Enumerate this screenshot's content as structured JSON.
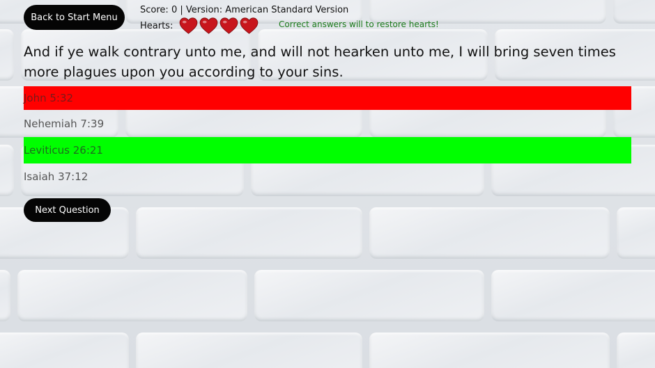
{
  "header": {
    "back_button_label": "Back to Start Menu",
    "score_label": "Score:",
    "score_value": "0",
    "separator": "|",
    "version_label": "Version:",
    "version_value": "American Standard Version",
    "hearts_label": "Hearts:",
    "hearts_count": 4,
    "heart_color": "#c8161d",
    "restore_message": "Correct answers will to restore hearts!"
  },
  "question": {
    "text": "And if ye walk contrary unto me, and will not hearken unto me, I will bring seven times more plagues upon you according to your sins."
  },
  "answers": [
    {
      "label": "John 5:32",
      "state": "wrong"
    },
    {
      "label": "Nehemiah 7:39",
      "state": "neutral"
    },
    {
      "label": "Leviticus 26:21",
      "state": "correct"
    },
    {
      "label": "Isaiah 37:12",
      "state": "neutral"
    }
  ],
  "footer": {
    "next_button_label": "Next Question"
  },
  "colors": {
    "wrong_answer_bg": "#ff0000",
    "correct_answer_bg": "#00ff00",
    "button_bg": "#050505",
    "restore_message": "#1a7a1a"
  }
}
